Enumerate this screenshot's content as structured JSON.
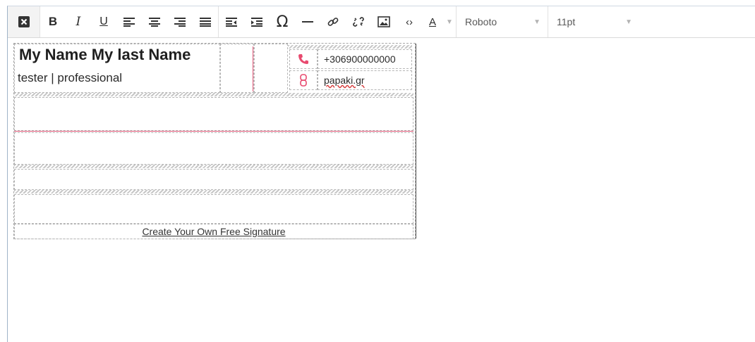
{
  "toolbar": {
    "buttons": [
      {
        "name": "clear-formatting-icon"
      },
      {
        "name": "bold-icon",
        "glyph": "B"
      },
      {
        "name": "italic-icon",
        "glyph": "I"
      },
      {
        "name": "underline-icon",
        "glyph": "U"
      },
      {
        "name": "align-left-icon"
      },
      {
        "name": "align-center-icon"
      },
      {
        "name": "align-right-icon"
      },
      {
        "name": "align-justify-icon"
      },
      {
        "name": "outdent-icon"
      },
      {
        "name": "indent-icon"
      },
      {
        "name": "special-character-icon",
        "glyph": "Ω"
      },
      {
        "name": "horizontal-line-icon",
        "glyph": "—"
      },
      {
        "name": "link-icon"
      },
      {
        "name": "unlink-icon"
      },
      {
        "name": "image-icon"
      },
      {
        "name": "source-code-icon",
        "glyph": "‹›"
      },
      {
        "name": "text-color-icon",
        "glyph": "A"
      }
    ],
    "font_family": "Roboto",
    "font_size": "11pt"
  },
  "signature": {
    "name": "My Name My last Name",
    "subtitle": "tester | professional",
    "phone": "+306900000000",
    "website": "papaki.gr",
    "footer_link": "Create Your Own Free Signature"
  },
  "colors": {
    "accent": "#e35a7a",
    "phone_icon": "#e84a6f",
    "link_icon": "#e84a6f",
    "toolbar_text": "#2b2b2b"
  }
}
